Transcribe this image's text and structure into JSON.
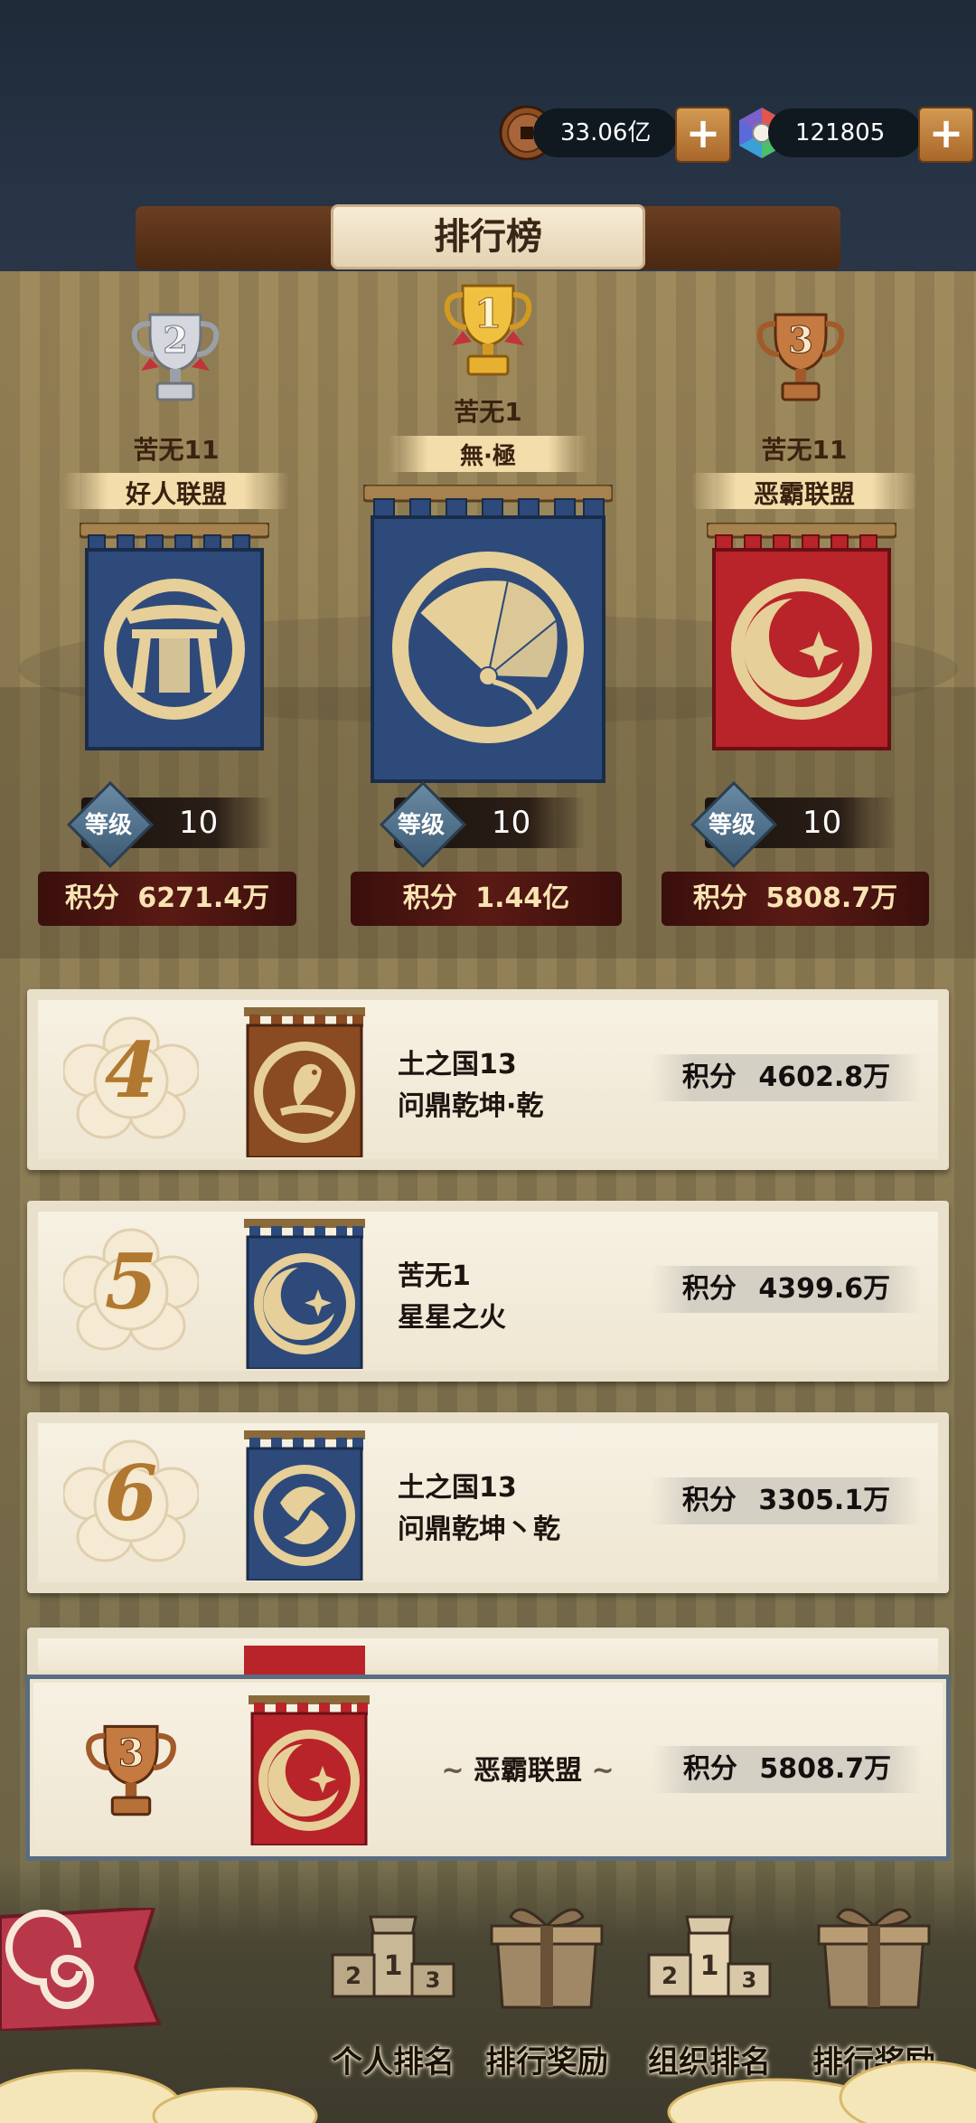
{
  "header": {
    "coins": "33.06亿",
    "gems": "121805",
    "title": "排行榜"
  },
  "top3": [
    {
      "rank": "2",
      "server": "苦无11",
      "guild": "好人联盟",
      "emblem": "torii-emblem",
      "banner_color": "#2e4a7a",
      "level_label": "等级",
      "level": "10",
      "score_label": "积分",
      "score": "6271.4万"
    },
    {
      "rank": "1",
      "server": "苦无1",
      "guild": "無·極",
      "emblem": "fan-emblem",
      "banner_color": "#2e4a7a",
      "level_label": "等级",
      "level": "10",
      "score_label": "积分",
      "score": "1.44亿"
    },
    {
      "rank": "3",
      "server": "苦无11",
      "guild": "恶霸联盟",
      "emblem": "crescent-star-emblem",
      "banner_color": "#b8242a",
      "level_label": "等级",
      "level": "10",
      "score_label": "积分",
      "score": "5808.7万"
    }
  ],
  "list": [
    {
      "rank": "4",
      "server": "土之国13",
      "guild": "问鼎乾坤·乾",
      "emblem": "bird-emblem",
      "banner_color": "#8a4a22",
      "score_label": "积分",
      "score": "4602.8万"
    },
    {
      "rank": "5",
      "server": "苦无1",
      "guild": "星星之火",
      "emblem": "crescent-star-emblem",
      "banner_color": "#2e4a7a",
      "score_label": "积分",
      "score": "4399.6万"
    },
    {
      "rank": "6",
      "server": "土之国13",
      "guild": "问鼎乾坤丶乾",
      "emblem": "koi-emblem",
      "banner_color": "#2e4a7a",
      "score_label": "积分",
      "score": "3305.1万"
    }
  ],
  "my_guild": {
    "rank": "3",
    "guild": "恶霸联盟",
    "emblem": "crescent-star-emblem",
    "banner_color": "#b8242a",
    "score_label": "积分",
    "score": "5808.7万"
  },
  "bottom_nav": [
    {
      "label": "个人排名",
      "icon": "podium-icon"
    },
    {
      "label": "排行奖励",
      "icon": "gift-box-icon"
    },
    {
      "label": "组织排名",
      "icon": "podium-icon"
    },
    {
      "label": "排行奖励",
      "icon": "gift-box-icon"
    }
  ],
  "colors": {
    "gold": "#e2b24a",
    "silver": "#c9ccd2",
    "bronze": "#b6703a",
    "score_bg": "#5a1a14"
  }
}
